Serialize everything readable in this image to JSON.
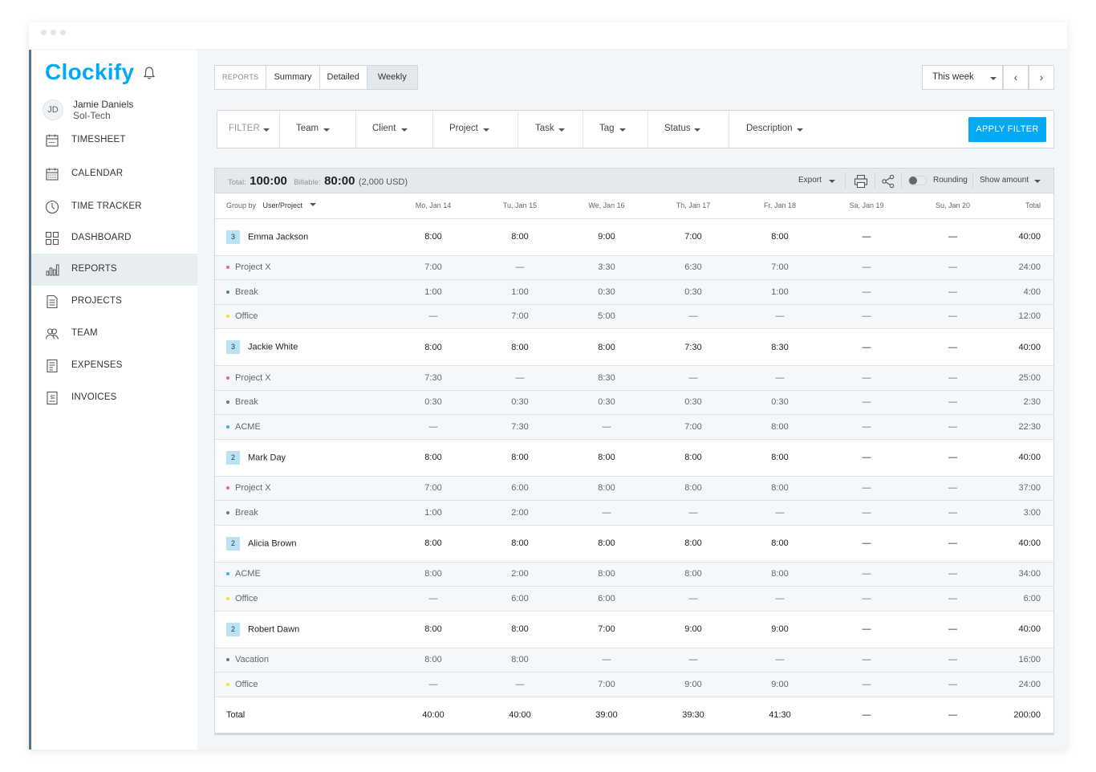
{
  "app": {
    "logo_text": "Clockify"
  },
  "user": {
    "initials": "JD",
    "name": "Jamie Daniels",
    "org": "Sol-Tech"
  },
  "sidebar": {
    "items": [
      {
        "label": "TIMESHEET",
        "icon": "timesheet-icon"
      },
      {
        "label": "CALENDAR",
        "icon": "calendar-icon"
      },
      {
        "label": "TIME TRACKER",
        "icon": "clock-icon"
      },
      {
        "label": "DASHBOARD",
        "icon": "dashboard-icon"
      },
      {
        "label": "REPORTS",
        "icon": "reports-icon",
        "active": true
      },
      {
        "label": "PROJECTS",
        "icon": "projects-icon"
      },
      {
        "label": "TEAM",
        "icon": "team-icon"
      },
      {
        "label": "EXPENSES",
        "icon": "expenses-icon"
      },
      {
        "label": "INVOICES",
        "icon": "invoices-icon"
      }
    ]
  },
  "report_tabs": {
    "label": "REPORTS",
    "tabs": [
      "Summary",
      "Detailed",
      "Weekly"
    ],
    "active": "Weekly"
  },
  "date_range": {
    "selected": "This week",
    "prev": "‹",
    "next": "›"
  },
  "filters": {
    "label": "FILTER",
    "items": [
      "Team",
      "Client",
      "Project",
      "Task",
      "Tag",
      "Status",
      "Description"
    ],
    "apply_label": "APPLY FILTER"
  },
  "summary": {
    "total_label": "Total:",
    "total_value": "100:00",
    "billable_label": "Billable:",
    "billable_value": "80:00",
    "amount": "(2,000 USD)",
    "export_label": "Export",
    "rounding_label": "Rounding",
    "show_amount_label": "Show amount"
  },
  "table": {
    "group_by_label": "Group by",
    "group_by_value": "User/Project",
    "columns": [
      "Mo, Jan 14",
      "Tu, Jan 15",
      "We, Jan 16",
      "Th, Jan 17",
      "Fr, Jan 18",
      "Sa, Jan 19",
      "Su, Jan 20",
      "Total"
    ],
    "groups": [
      {
        "name": "Emma Jackson",
        "count": "3",
        "values": [
          "8:00",
          "8:00",
          "9:00",
          "7:00",
          "8:00",
          "—",
          "—",
          "40:00"
        ],
        "projects": [
          {
            "name": "Project X",
            "color": "#f06292",
            "values": [
              "7:00",
              "—",
              "3:30",
              "6:30",
              "7:00",
              "—",
              "—",
              "24:00"
            ]
          },
          {
            "name": "Break",
            "color": "#607d8b",
            "values": [
              "1:00",
              "1:00",
              "0:30",
              "0:30",
              "1:00",
              "—",
              "—",
              "4:00"
            ]
          },
          {
            "name": "Office",
            "color": "#fdd835",
            "values": [
              "—",
              "7:00",
              "5:00",
              "—",
              "—",
              "—",
              "—",
              "12:00"
            ]
          }
        ]
      },
      {
        "name": "Jackie White",
        "count": "3",
        "values": [
          "8:00",
          "8:00",
          "8:00",
          "7:30",
          "8:30",
          "—",
          "—",
          "40:00"
        ],
        "projects": [
          {
            "name": "Project X",
            "color": "#f06292",
            "values": [
              "7:30",
              "—",
              "8:30",
              "—",
              "—",
              "—",
              "—",
              "25:00"
            ]
          },
          {
            "name": "Break",
            "color": "#607d8b",
            "values": [
              "0:30",
              "0:30",
              "0:30",
              "0:30",
              "0:30",
              "—",
              "—",
              "2:30"
            ]
          },
          {
            "name": "ACME",
            "color": "#29b6f6",
            "values": [
              "—",
              "7:30",
              "—",
              "7:00",
              "8:00",
              "—",
              "—",
              "22:30"
            ]
          }
        ]
      },
      {
        "name": "Mark Day",
        "count": "2",
        "values": [
          "8:00",
          "8:00",
          "8:00",
          "8:00",
          "8:00",
          "—",
          "—",
          "40:00"
        ],
        "projects": [
          {
            "name": "Project X",
            "color": "#f06292",
            "values": [
              "7:00",
              "6:00",
              "8:00",
              "8:00",
              "8:00",
              "—",
              "—",
              "37:00"
            ]
          },
          {
            "name": "Break",
            "color": "#607d8b",
            "values": [
              "1:00",
              "2:00",
              "—",
              "—",
              "—",
              "—",
              "—",
              "3:00"
            ]
          }
        ]
      },
      {
        "name": "Alicia Brown",
        "count": "2",
        "values": [
          "8:00",
          "8:00",
          "8:00",
          "8:00",
          "8:00",
          "—",
          "—",
          "40:00"
        ],
        "projects": [
          {
            "name": "ACME",
            "color": "#29b6f6",
            "values": [
              "8:00",
              "2:00",
              "8:00",
              "8:00",
              "8:00",
              "—",
              "—",
              "34:00"
            ]
          },
          {
            "name": "Office",
            "color": "#fdd835",
            "values": [
              "—",
              "6:00",
              "6:00",
              "—",
              "—",
              "—",
              "—",
              "6:00"
            ]
          }
        ]
      },
      {
        "name": "Robert Dawn",
        "count": "2",
        "values": [
          "8:00",
          "8:00",
          "7:00",
          "9:00",
          "9:00",
          "—",
          "—",
          "40:00"
        ],
        "projects": [
          {
            "name": "Vacation",
            "color": "#607d8b",
            "values": [
              "8:00",
              "8:00",
              "—",
              "—",
              "—",
              "—",
              "—",
              "16:00"
            ]
          },
          {
            "name": "Office",
            "color": "#fdd835",
            "values": [
              "—",
              "—",
              "7:00",
              "9:00",
              "9:00",
              "—",
              "—",
              "24:00"
            ]
          }
        ]
      }
    ],
    "totals": {
      "label": "Total",
      "values": [
        "40:00",
        "40:00",
        "39:00",
        "39:30",
        "41:30",
        "—",
        "—",
        "200:00"
      ]
    }
  },
  "colors": {
    "accent": "#03a9f4",
    "sidebar_active": "#e8edf0",
    "count_badge": "#b9e3f5"
  }
}
